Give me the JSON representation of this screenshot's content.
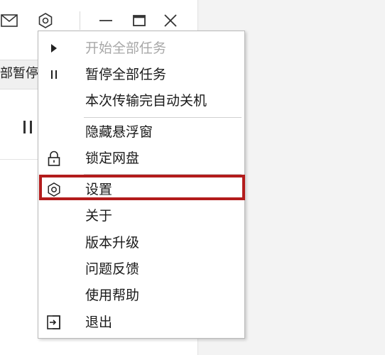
{
  "app": {
    "partial_button_label": "部暂停",
    "title_bar": {
      "icons": [
        "mail-icon",
        "gear-icon",
        "minimize-icon",
        "maximize-icon",
        "close-icon"
      ]
    }
  },
  "context_menu": {
    "items": [
      {
        "label": "开始全部任务",
        "icon": "play-icon",
        "disabled": true
      },
      {
        "label": "暂停全部任务",
        "icon": "pause-icon",
        "disabled": false
      },
      {
        "label": "本次传输完自动关机",
        "icon": "",
        "disabled": false
      },
      {
        "label": "隐藏悬浮窗",
        "icon": "",
        "disabled": false
      },
      {
        "label": "锁定网盘",
        "icon": "lock-icon",
        "disabled": false
      },
      {
        "label": "设置",
        "icon": "gear-icon",
        "disabled": false,
        "highlighted": true
      },
      {
        "label": "关于",
        "icon": "",
        "disabled": false
      },
      {
        "label": "版本升级",
        "icon": "",
        "disabled": false
      },
      {
        "label": "问题反馈",
        "icon": "",
        "disabled": false
      },
      {
        "label": "使用帮助",
        "icon": "",
        "disabled": false
      },
      {
        "label": "退出",
        "icon": "exit-icon",
        "disabled": false
      }
    ]
  },
  "colors": {
    "highlight_border": "#b31c1c",
    "disabled_text": "#a8a8a8",
    "text": "#1a1a1a"
  }
}
